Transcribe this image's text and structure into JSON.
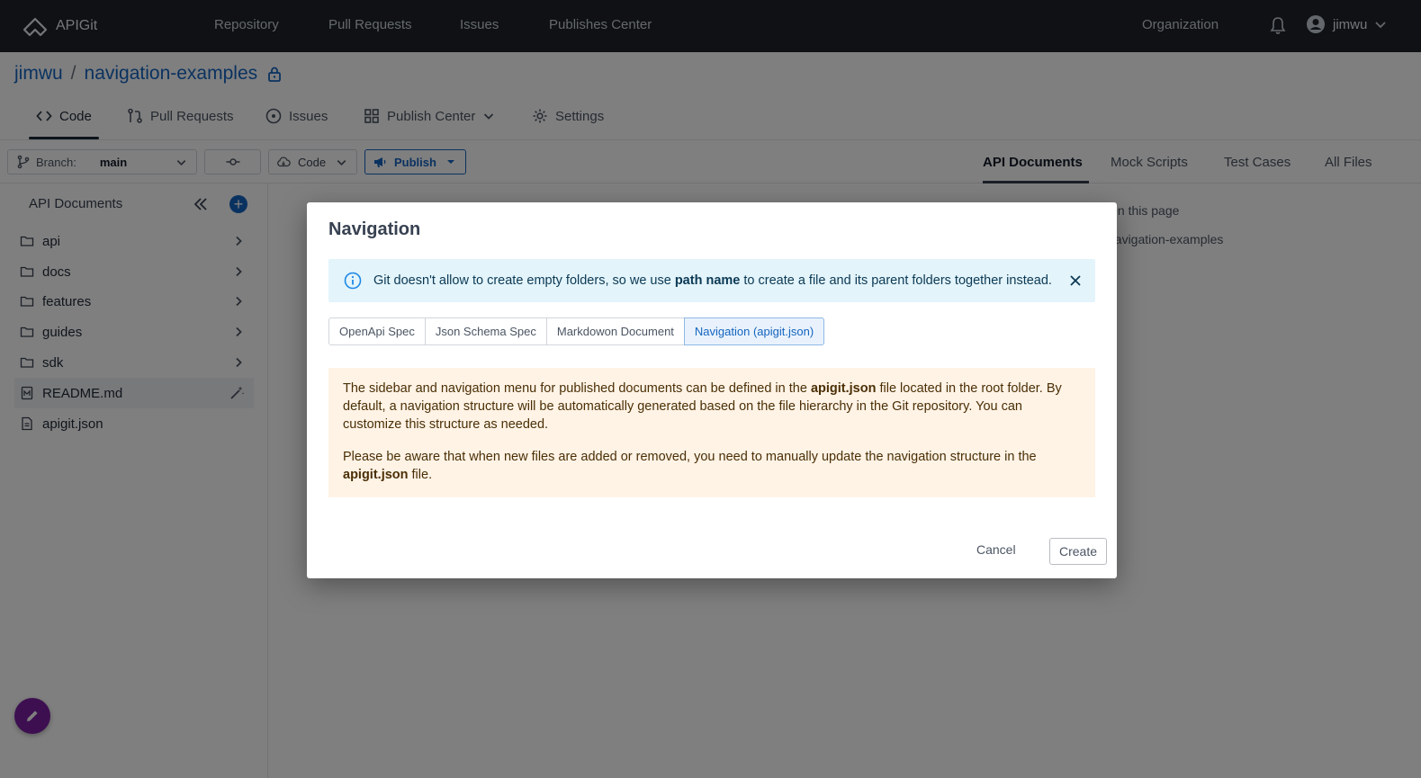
{
  "app": {
    "name": "APIGit"
  },
  "topnav": {
    "items": [
      "Repository",
      "Pull Requests",
      "Issues",
      "Publishes Center"
    ],
    "organization": "Organization",
    "username": "jimwu"
  },
  "repo": {
    "owner": "jimwu",
    "separator": "/",
    "name": "navigation-examples"
  },
  "repo_tabs": [
    {
      "label": "Code",
      "icon": "code-icon"
    },
    {
      "label": "Pull Requests",
      "icon": "pull-request-icon"
    },
    {
      "label": "Issues",
      "icon": "issue-icon"
    },
    {
      "label": "Publish Center",
      "icon": "grid-icon"
    },
    {
      "label": "Settings",
      "icon": "gear-icon"
    }
  ],
  "toolbar": {
    "branch_label": "Branch:",
    "branch_value": "main",
    "code_label": "Code",
    "publish_label": "Publish"
  },
  "right_tabs": [
    "API Documents",
    "Mock Scripts",
    "Test Cases",
    "All Files"
  ],
  "sidebar": {
    "title": "API Documents",
    "items": [
      {
        "label": "api",
        "type": "folder"
      },
      {
        "label": "docs",
        "type": "folder"
      },
      {
        "label": "features",
        "type": "folder"
      },
      {
        "label": "guides",
        "type": "folder"
      },
      {
        "label": "sdk",
        "type": "folder"
      },
      {
        "label": "README.md",
        "type": "markdown"
      },
      {
        "label": "apigit.json",
        "type": "file"
      }
    ]
  },
  "on_this_page": {
    "title": "On this page",
    "item": "navigation-examples"
  },
  "modal": {
    "title": "Navigation",
    "info": {
      "pre": "Git doesn't allow to create empty folders, so we use ",
      "bold": "path name",
      "post": " to create a file and its parent folders together instead."
    },
    "tabs": [
      "OpenApi Spec",
      "Json Schema Spec",
      "Markdowon Document",
      "Navigation (apigit.json)"
    ],
    "active_tab": "Navigation (apigit.json)",
    "para1": {
      "pre": "The sidebar and navigation menu for published documents can be defined in the ",
      "bold": "apigit.json",
      "post": " file located in the root folder. By default, a navigation structure will be automatically generated based on the file hierarchy in the Git repository. You can customize this structure as needed."
    },
    "para2": {
      "pre": "Please be aware that when new files are added or removed, you need to manually update the navigation structure in the ",
      "bold": "apigit.json",
      "post": " file."
    },
    "cancel_label": "Cancel",
    "create_label": "Create"
  },
  "colors": {
    "topbar": "#1f2328",
    "accent": "#1565c0",
    "fab": "#7b1fa2",
    "info_bg": "#e3f4fb",
    "warn_bg": "#fff3e6"
  }
}
